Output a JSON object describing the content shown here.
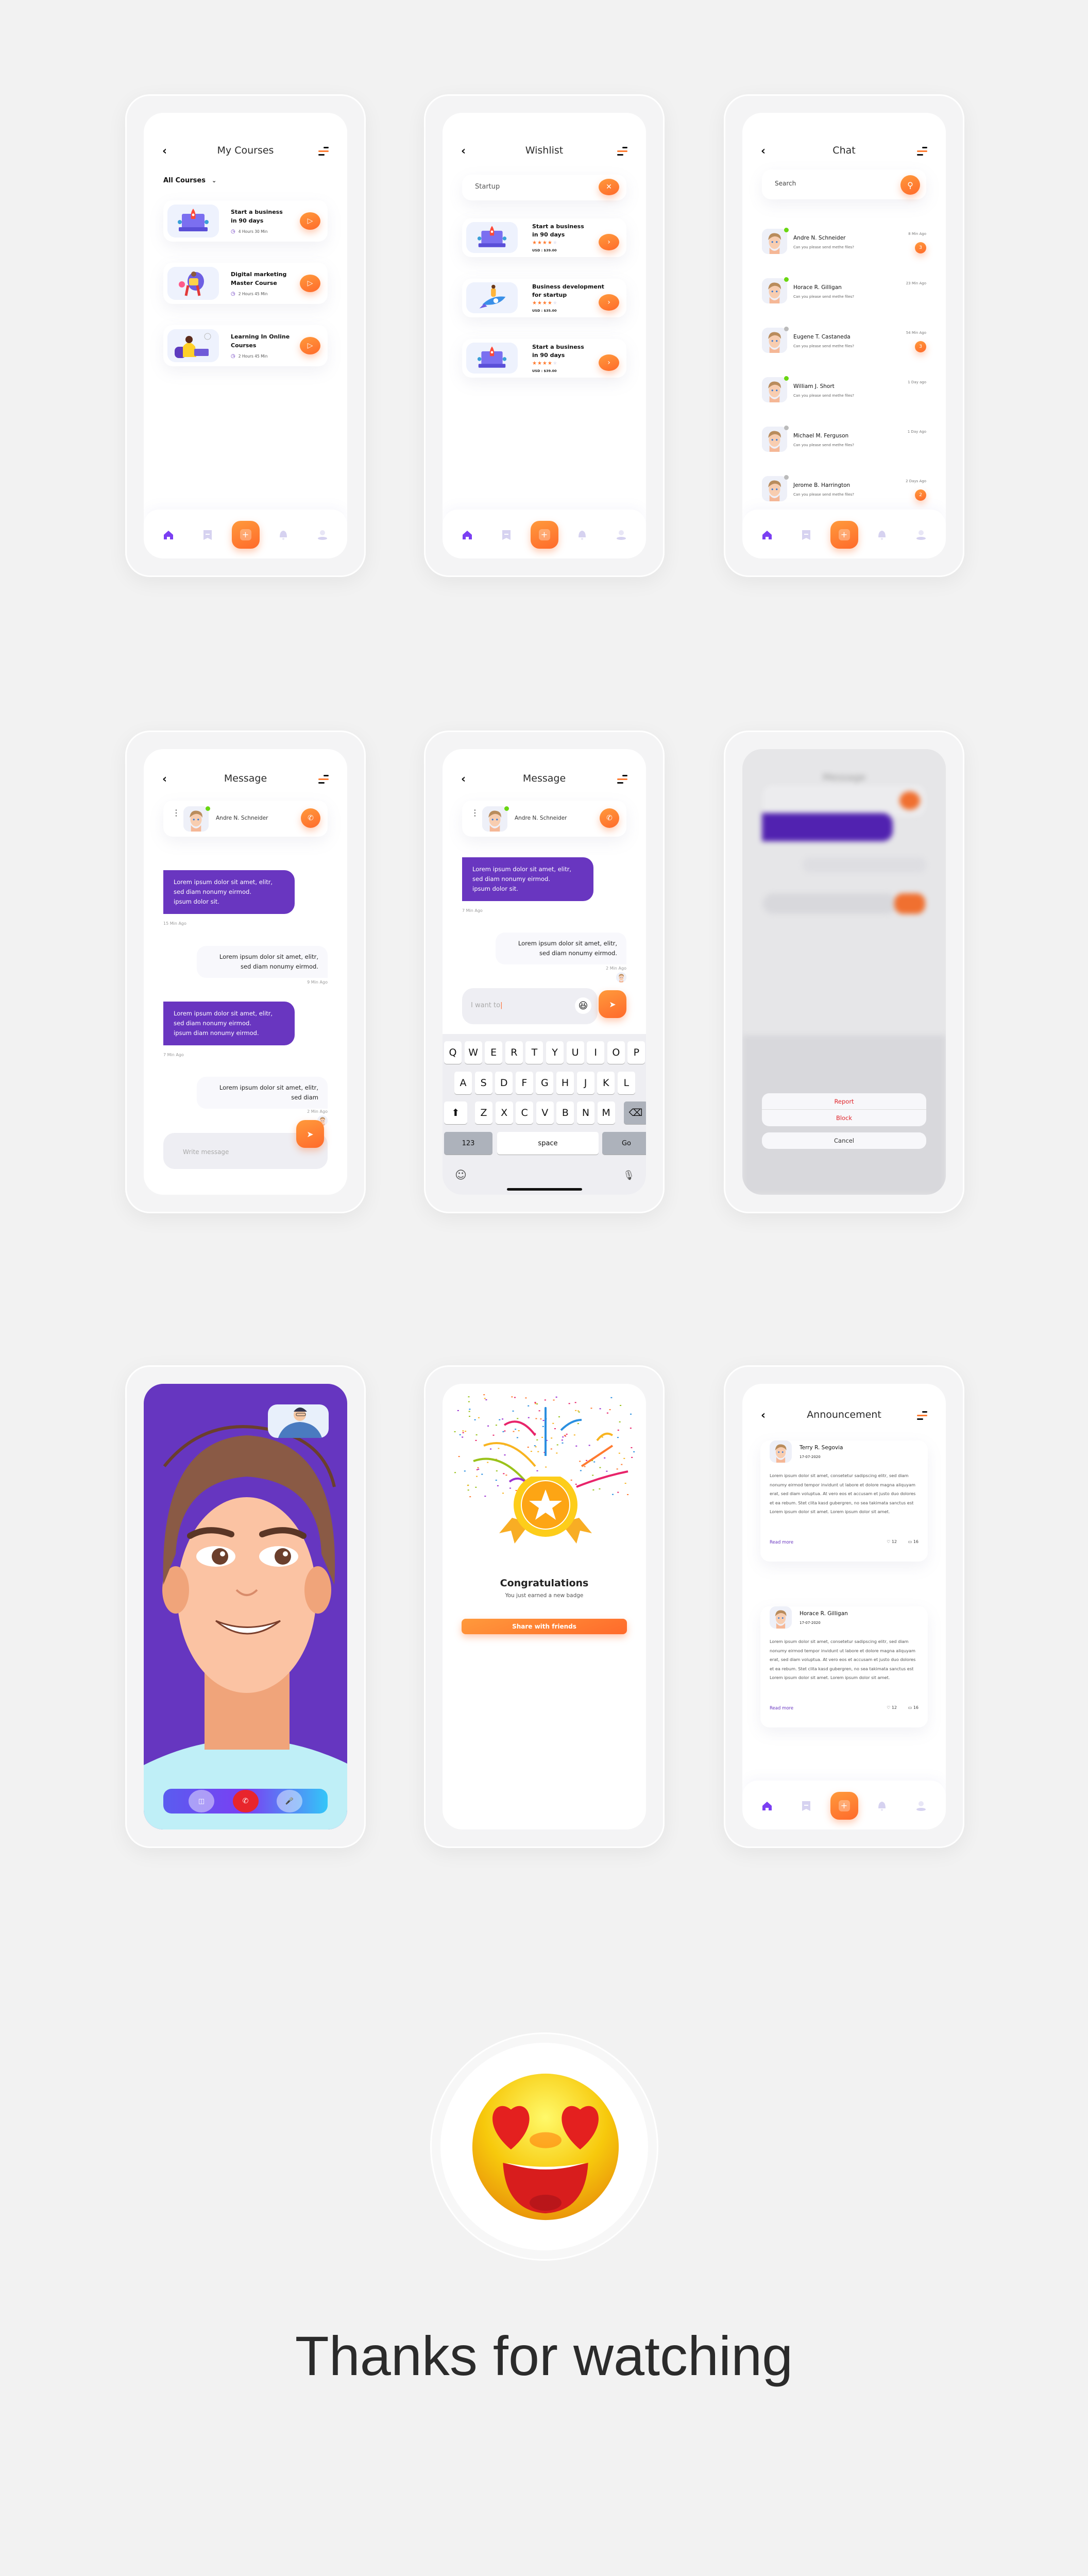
{
  "nav_icons": [
    "home-icon",
    "bookmark-icon",
    "add-icon",
    "bell-icon",
    "profile-icon"
  ],
  "colors": {
    "accent_orange": "#ff7a2f",
    "accent_purple": "#6936c0",
    "background": "#f2f2f2",
    "online": "#6ad612",
    "offline": "#bbbbbb",
    "danger": "#e0242a"
  },
  "my_courses": {
    "title": "My Courses",
    "filter_label": "All Courses",
    "courses": [
      {
        "title_1": "Start a business",
        "title_2": "in 90 days",
        "duration": "4 Hours 30 Min"
      },
      {
        "title_1": "Digital marketing",
        "title_2": "Master Course",
        "duration": "2 Hours 45 Min"
      },
      {
        "title_1": "Learning In Online",
        "title_2": "Courses",
        "duration": "2 Hours 45 Min"
      }
    ]
  },
  "wishlist": {
    "title": "Wishlist",
    "search_value": "Startup",
    "items": [
      {
        "title_1": "Start a business",
        "title_2": "in 90 days",
        "rating": 4,
        "max_rating": 5,
        "price": "USD : $39.00"
      },
      {
        "title_1": "Business development",
        "title_2": "for startup",
        "rating": 4,
        "max_rating": 5,
        "price": "USD : $35.00"
      },
      {
        "title_1": "Start a business",
        "title_2": "in 90 days",
        "rating": 4,
        "max_rating": 5,
        "price": "USD : $39.00"
      }
    ]
  },
  "chat": {
    "title": "Chat",
    "search_placeholder": "Search",
    "conversations": [
      {
        "name": "Andre N. Schneider",
        "preview": "Can you please send methe files?",
        "time": "8 Min Ago",
        "unread": "3",
        "online": true
      },
      {
        "name": "Horace R. Gilligan",
        "preview": "Can you please send methe files?",
        "time": "23 Min Ago",
        "unread": "",
        "online": true
      },
      {
        "name": "Eugene T. Castaneda",
        "preview": "Can you please send methe files?",
        "time": "54 Min Ago",
        "unread": "3",
        "online": false
      },
      {
        "name": "William J. Short",
        "preview": "Can you please send methe files?",
        "time": "1 Day ago",
        "unread": "",
        "online": true
      },
      {
        "name": "Michael M. Ferguson",
        "preview": "Can you please send methe files?",
        "time": "1 Day Ago",
        "unread": "",
        "online": false
      },
      {
        "name": "Jerome B. Harrington",
        "preview": "Can you please send methe files?",
        "time": "2 Days Ago",
        "unread": "2",
        "online": false
      }
    ]
  },
  "message1": {
    "title": "Message",
    "contact": "Andre N. Schneider",
    "messages": [
      {
        "dir": "in",
        "lines": [
          "Lorem ipsum dolor sit amet,  elitr,",
          "sed diam nonumy eirmod.",
          "ipsum dolor sit."
        ],
        "time": "15 Min Ago"
      },
      {
        "dir": "out",
        "lines": [
          "Lorem ipsum dolor sit amet,  elitr,",
          "sed diam nonumy eirmod."
        ],
        "time": "9 Min Ago"
      },
      {
        "dir": "in",
        "lines": [
          "Lorem ipsum dolor sit amet,  elitr,",
          "sed diam nonumy eirmod.",
          "ipsum diam nonumy eirmod."
        ],
        "time": "7 Min Ago"
      },
      {
        "dir": "out",
        "lines": [
          "Lorem ipsum dolor sit amet,  elitr,",
          "sed diam"
        ],
        "time": "2 Min Ago"
      }
    ],
    "input_placeholder": "Write message"
  },
  "message2": {
    "title": "Message",
    "contact": "Andre N. Schneider",
    "messages": [
      {
        "dir": "in",
        "lines": [
          "Lorem ipsum dolor sit amet,  elitr,",
          "sed diam nonumy eirmod.",
          "ipsum dolor sit."
        ],
        "time": "7 Min Ago"
      },
      {
        "dir": "out",
        "lines": [
          "Lorem ipsum dolor sit amet,  elitr,",
          "sed diam nonumy eirmod."
        ],
        "time": "2 Min Ago"
      }
    ],
    "input_value": "I want to",
    "keyboard": {
      "row1": [
        "Q",
        "W",
        "E",
        "R",
        "T",
        "Y",
        "U",
        "I",
        "O",
        "P"
      ],
      "row2": [
        "A",
        "S",
        "D",
        "F",
        "G",
        "H",
        "J",
        "K",
        "L"
      ],
      "row3": [
        "Z",
        "X",
        "C",
        "V",
        "B",
        "N",
        "M"
      ],
      "numbers_key": "123",
      "space_key": "space",
      "go_key": "Go"
    }
  },
  "action_sheet": {
    "title": "Message",
    "report": "Report",
    "block": "Block",
    "cancel": "Cancel"
  },
  "video_call": {
    "controls": [
      "video-camera-icon",
      "end-call-icon",
      "microphone-icon"
    ]
  },
  "badge": {
    "title": "Congratulations",
    "subtitle": "You just earned a new badge",
    "button": "Share with friends"
  },
  "announcement": {
    "title": "Announcement",
    "posts": [
      {
        "author": "Terry R. Segovia",
        "date": "17-07-2020",
        "body": "Lorem ipsum dolor sit amet, consetetur sadipscing elitr, sed diam nonumy eirmod tempor invidunt ut labore et dolore magna aliquyam erat, sed diam voluptua. At vero eos et accusam et justo duo dolores et ea rebum. Stet clita kasd gubergren, no sea takimata sanctus est Lorem ipsum dolor sit amet. Lorem ipsum dolor sit amet.",
        "read_more": "Read more",
        "likes": "12",
        "comments": "16"
      },
      {
        "author": "Horace R. Gilligan",
        "date": "17-07-2020",
        "body": "Lorem ipsum dolor sit amet, consetetur sadipscing elitr, sed diam nonumy eirmod tempor invidunt ut labore et dolore magna aliquyam erat, sed diam voluptua. At vero eos et accusam et justo duo dolores et ea rebum. Stet clita kasd gubergren, no sea takimata sanctus est Lorem ipsum dolor sit amet. Lorem ipsum dolor sit amet.",
        "read_more": "Read more",
        "likes": "12",
        "comments": "16"
      }
    ]
  },
  "footer": {
    "text": "Thanks for watching"
  }
}
